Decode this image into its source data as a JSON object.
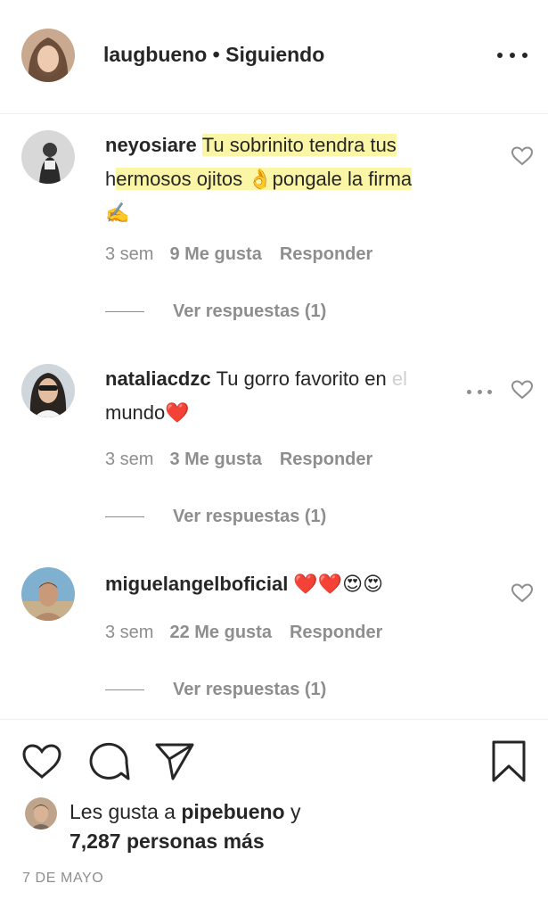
{
  "post_header": {
    "username": "laugbueno",
    "separator": "•",
    "follow_status": "Siguiendo",
    "more_icon": "more-horizontal-icon"
  },
  "comments": [
    {
      "username": "neyosiare",
      "text_line1": "Tu sobrinito tendra tus",
      "text_line2_prefix": "h",
      "text_line2_highlight": "ermosos ojitos ",
      "emoji1": "👌",
      "text_line2_highlight2": "pongale la firma",
      "emoji2": "✍️",
      "time": "3 sem",
      "likes": "9 Me gusta",
      "reply": "Responder",
      "view_replies": "Ver respuestas (1)"
    },
    {
      "username": "nataliacdzc",
      "text": "Tu gorro favorito en el mundo",
      "text_a": "Tu gorro favorito en",
      "text_b": "el",
      "text_line2": "mundo",
      "emoji": "❤️",
      "time": "3 sem",
      "likes": "3 Me gusta",
      "reply": "Responder",
      "view_replies": "Ver respuestas (1)"
    },
    {
      "username": "miguelangelboficial",
      "emoji": "❤️❤️😍😍",
      "time": "3 sem",
      "likes": "22 Me gusta",
      "reply": "Responder",
      "view_replies": "Ver respuestas (1)"
    }
  ],
  "actions": {
    "like_icon": "heart-icon",
    "comment_icon": "comment-bubble-icon",
    "share_icon": "paper-plane-icon",
    "save_icon": "bookmark-icon"
  },
  "likes_summary": {
    "prefix": "Les gusta a",
    "user": "pipebueno",
    "connector": "y",
    "count": "7,287 personas más"
  },
  "date": "7 DE MAYO"
}
